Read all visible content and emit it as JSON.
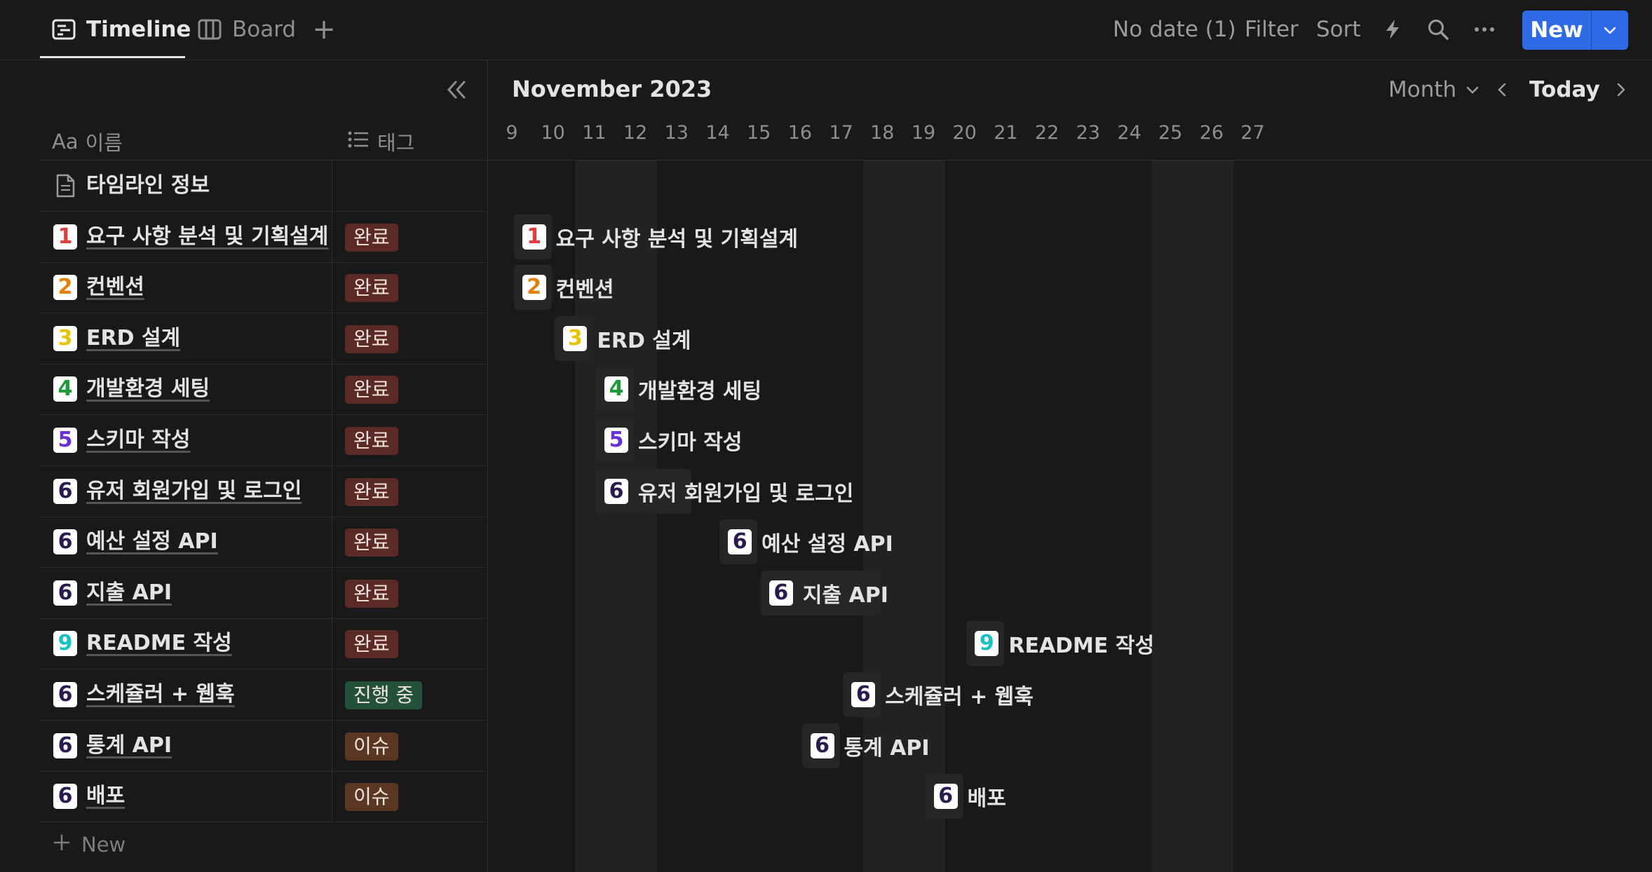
{
  "views": {
    "timeline": {
      "label": "Timeline",
      "icon": "timeline-icon"
    },
    "board": {
      "label": "Board",
      "icon": "board-icon"
    },
    "add": "+"
  },
  "toolbar": {
    "no_date": "No date (1)",
    "filter": "Filter",
    "sort": "Sort",
    "new": "New"
  },
  "table": {
    "name_header_prefix": "Aa",
    "name_header": "이름",
    "tag_header": "태그",
    "new_row": "New"
  },
  "calendar": {
    "month": "November 2023",
    "range": "Month",
    "today": "Today",
    "days": [
      "9",
      "10",
      "11",
      "12",
      "13",
      "14",
      "15",
      "16",
      "17",
      "18",
      "19",
      "20",
      "21",
      "22",
      "23",
      "24",
      "25",
      "26",
      "27"
    ]
  },
  "status_colors": {
    "완료": "#5c2a26",
    "진행 중": "#24513a",
    "이슈": "#5a3723"
  },
  "rows": [
    {
      "name": "타임라인 정보",
      "num": null,
      "tag": "",
      "type": "doc"
    },
    {
      "name": "요구 사항 분석 및 기획설계",
      "num": "1",
      "numColor": "#e03e3e",
      "tag": "완료"
    },
    {
      "name": "컨벤션",
      "num": "2",
      "numColor": "#e57f08",
      "tag": "완료"
    },
    {
      "name": "ERD 설계",
      "num": "3",
      "numColor": "#e6c500",
      "tag": "완료"
    },
    {
      "name": "개발환경 세팅",
      "num": "4",
      "numColor": "#1f9a3a",
      "tag": "완료"
    },
    {
      "name": "스키마 작성",
      "num": "5",
      "numColor": "#6a2fd6",
      "tag": "완료"
    },
    {
      "name": "유저 회원가입 및 로그인",
      "num": "6",
      "numColor": "#2a1a4e",
      "tag": "완료"
    },
    {
      "name": "예산 설정 API",
      "num": "6",
      "numColor": "#2a1a4e",
      "tag": "완료"
    },
    {
      "name": "지출 API",
      "num": "6",
      "numColor": "#2a1a4e",
      "tag": "완료"
    },
    {
      "name": "README 작성",
      "num": "9",
      "numColor": "#18c2c2",
      "tag": "완료"
    },
    {
      "name": "스케쥴러 + 웹훅",
      "num": "6",
      "numColor": "#2a1a4e",
      "tag": "진행 중"
    },
    {
      "name": "통계 API",
      "num": "6",
      "numColor": "#2a1a4e",
      "tag": "이슈"
    },
    {
      "name": "배포",
      "num": "6",
      "numColor": "#2a1a4e",
      "tag": "이슈"
    }
  ],
  "bars": [
    {
      "row": 1,
      "label": "요구 사항 분석 및 기획설계",
      "start": 9,
      "end": 9.5
    },
    {
      "row": 2,
      "label": "컨벤션",
      "start": 9,
      "end": 9.5
    },
    {
      "row": 3,
      "label": "ERD 설계",
      "start": 10,
      "end": 10.5
    },
    {
      "row": 4,
      "label": "개발환경 세팅",
      "start": 11,
      "end": 11.5
    },
    {
      "row": 5,
      "label": "스키마 작성",
      "start": 11,
      "end": 11.5
    },
    {
      "row": 6,
      "label": "유저 회원가입 및 로그인",
      "start": 11,
      "end": 12.9
    },
    {
      "row": 7,
      "label": "예산 설정 API",
      "start": 14,
      "end": 14.5
    },
    {
      "row": 8,
      "label": "지출 API",
      "start": 15,
      "end": 17.5
    },
    {
      "row": 9,
      "label": "README 작성",
      "start": 20,
      "end": 20.5
    },
    {
      "row": 10,
      "label": "스케쥴러 + 웹훅",
      "start": 17,
      "end": 17.5
    },
    {
      "row": 11,
      "label": "통계 API",
      "start": 16,
      "end": 16.5
    },
    {
      "row": 12,
      "label": "배포",
      "start": 19,
      "end": 19.5
    }
  ]
}
